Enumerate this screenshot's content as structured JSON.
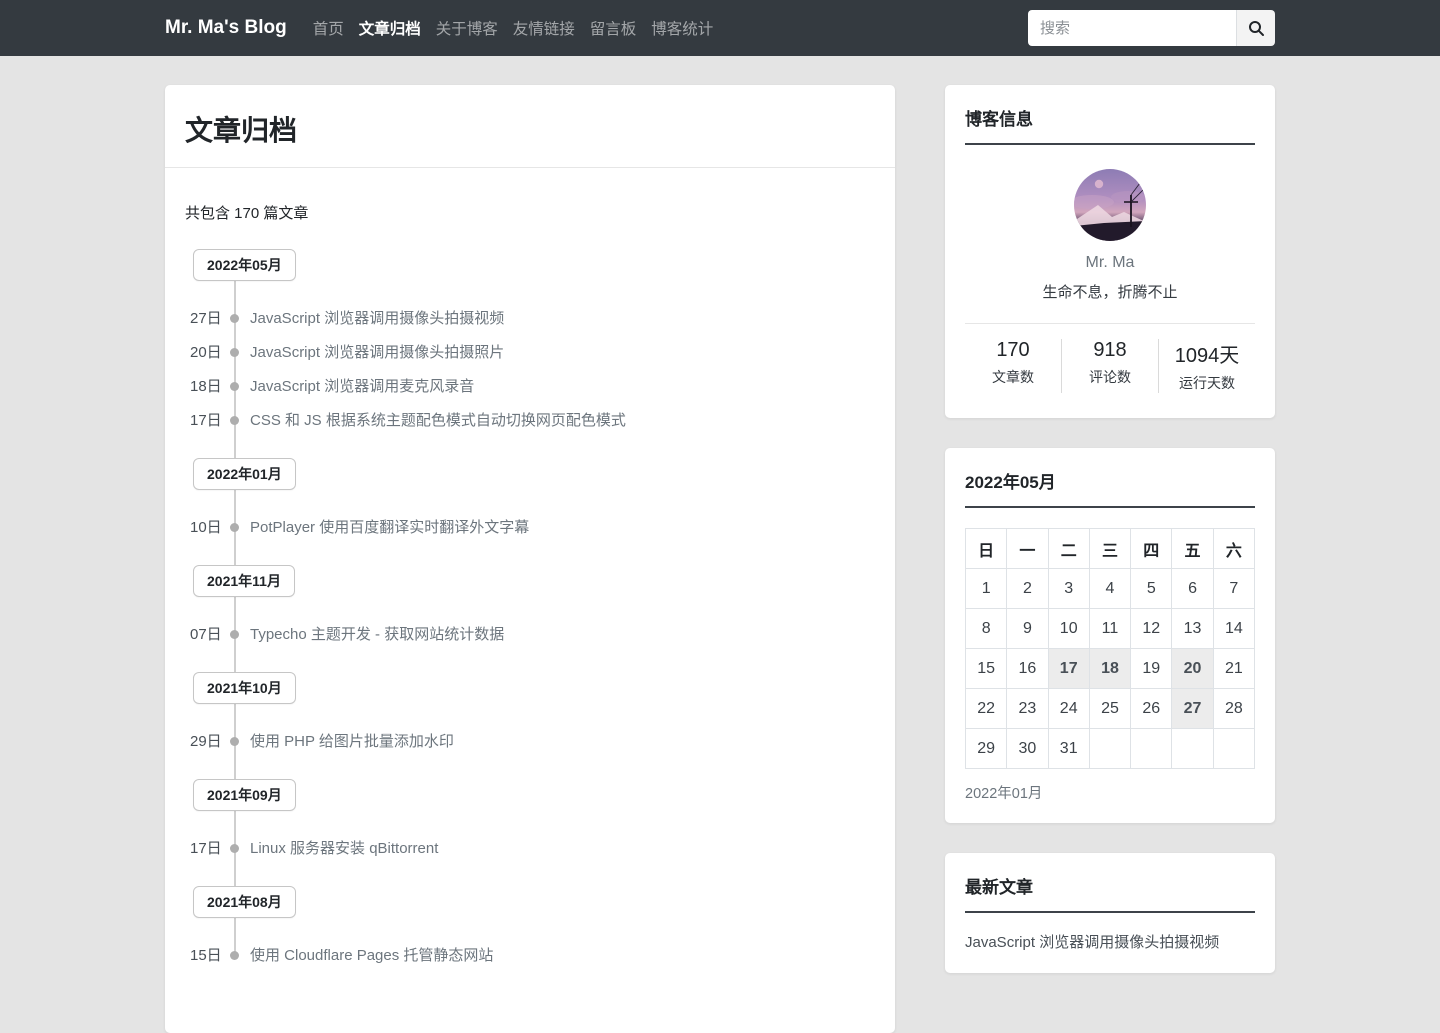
{
  "navbar": {
    "brand": "Mr. Ma's Blog",
    "items": [
      {
        "id": "home",
        "label": "首页",
        "active": false
      },
      {
        "id": "archive",
        "label": "文章归档",
        "active": true
      },
      {
        "id": "about",
        "label": "关于博客",
        "active": false
      },
      {
        "id": "links",
        "label": "友情链接",
        "active": false
      },
      {
        "id": "guestbook",
        "label": "留言板",
        "active": false
      },
      {
        "id": "stats",
        "label": "博客统计",
        "active": false
      }
    ],
    "search": {
      "placeholder": "搜索",
      "icon": "search-icon"
    }
  },
  "archive": {
    "title": "文章归档",
    "summary": "共包含 170 篇文章",
    "groups": [
      {
        "month": "2022年05月",
        "posts": [
          {
            "day": "27日",
            "title": "JavaScript 浏览器调用摄像头拍摄视频"
          },
          {
            "day": "20日",
            "title": "JavaScript 浏览器调用摄像头拍摄照片"
          },
          {
            "day": "18日",
            "title": "JavaScript 浏览器调用麦克风录音"
          },
          {
            "day": "17日",
            "title": "CSS 和 JS 根据系统主题配色模式自动切换网页配色模式"
          }
        ]
      },
      {
        "month": "2022年01月",
        "posts": [
          {
            "day": "10日",
            "title": "PotPlayer 使用百度翻译实时翻译外文字幕"
          }
        ]
      },
      {
        "month": "2021年11月",
        "posts": [
          {
            "day": "07日",
            "title": "Typecho 主题开发 - 获取网站统计数据"
          }
        ]
      },
      {
        "month": "2021年10月",
        "posts": [
          {
            "day": "29日",
            "title": "使用 PHP 给图片批量添加水印"
          }
        ]
      },
      {
        "month": "2021年09月",
        "posts": [
          {
            "day": "17日",
            "title": "Linux 服务器安装 qBittorrent"
          }
        ]
      },
      {
        "month": "2021年08月",
        "posts": [
          {
            "day": "15日",
            "title": "使用 Cloudflare Pages 托管静态网站"
          }
        ]
      }
    ]
  },
  "blog_info": {
    "title": "博客信息",
    "name": "Mr. Ma",
    "motto": "生命不息，折腾不止",
    "avatar": "sunset-sky-avatar",
    "stats": [
      {
        "id": "articles",
        "value": "170",
        "label": "文章数"
      },
      {
        "id": "comments",
        "value": "918",
        "label": "评论数"
      },
      {
        "id": "days",
        "value": "1094天",
        "label": "运行天数"
      }
    ]
  },
  "calendar": {
    "title": "2022年05月",
    "weekdays": [
      "日",
      "一",
      "二",
      "三",
      "四",
      "五",
      "六"
    ],
    "weeks": [
      [
        "1",
        "2",
        "3",
        "4",
        "5",
        "6",
        "7"
      ],
      [
        "8",
        "9",
        "10",
        "11",
        "12",
        "13",
        "14"
      ],
      [
        "15",
        "16",
        "17",
        "18",
        "19",
        "20",
        "21"
      ],
      [
        "22",
        "23",
        "24",
        "25",
        "26",
        "27",
        "28"
      ],
      [
        "29",
        "30",
        "31",
        "",
        "",
        "",
        ""
      ]
    ],
    "highlighted_days": [
      "17",
      "18",
      "20",
      "27"
    ],
    "prev_month_link": "2022年01月"
  },
  "latest": {
    "title": "最新文章",
    "items": [
      "JavaScript 浏览器调用摄像头拍摄视频"
    ]
  },
  "colors": {
    "navbar_bg": "#343a40",
    "page_bg": "#e4e4e4",
    "card_bg": "#ffffff",
    "calendar_highlight_bg": "#ececec",
    "muted_link": "#6c757d"
  }
}
